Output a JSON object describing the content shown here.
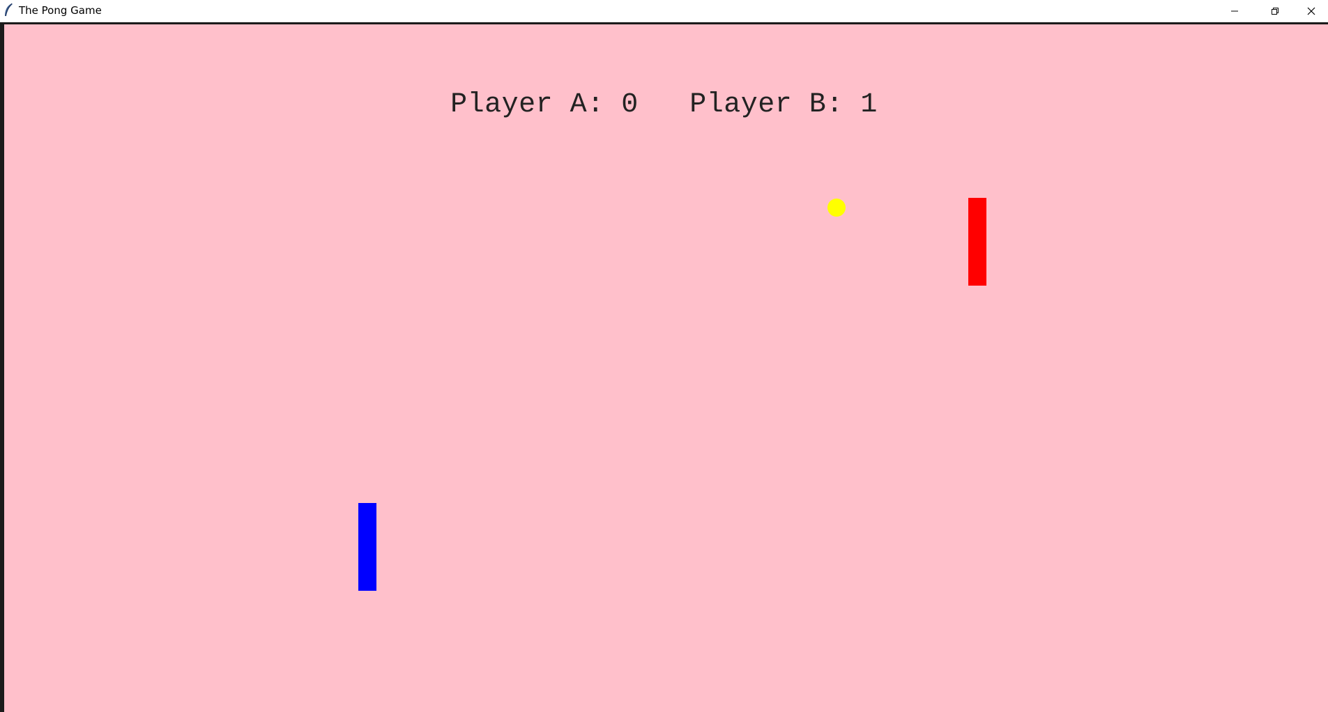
{
  "window": {
    "title": "The Pong Game",
    "controls": {
      "minimize_icon": "minimize-icon",
      "maximize_icon": "restore-icon",
      "close_icon": "close-icon"
    }
  },
  "game": {
    "background_color": "#ffc0cb",
    "score": {
      "player_a_label": "Player A:",
      "player_a": 0,
      "player_b_label": "Player B:",
      "player_b": 1
    },
    "paddle_a": {
      "color": "#0000ff"
    },
    "paddle_b": {
      "color": "#ff0000"
    },
    "ball": {
      "color": "#ffff00"
    }
  }
}
